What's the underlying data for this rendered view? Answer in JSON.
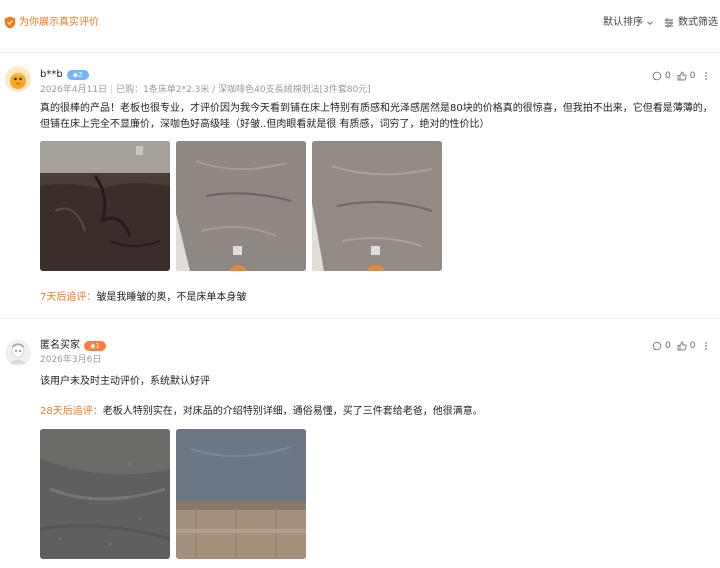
{
  "header": {
    "title": "为你展示真实评价",
    "sort_label": "默认排序",
    "digital_label": "数式筛选"
  },
  "reviews": [
    {
      "user": "b**b",
      "badge": "◆2",
      "date": "2026年4月11日",
      "purchased": "已购：1条床单2*2.3米 / 深咖啡色40支長絨棉刺法[3件套80元]",
      "comment_count": "0",
      "like_count": "0",
      "text_line1": "真的很棒的产品！老板也很专业，才评价因为我今天看到铺在床上特别有质感和光泽感居然是80块的价格真的很惊喜，但我拍不出来，它但看是薄薄的，",
      "text_line2": "但铺在床上完全不显廉价，深咖色好高级哇（好皱..但肉眼看就是很 有质感，词穷了，绝对的性价比）",
      "followup_tag": "7天后追评：",
      "followup_text": "皱是我睡皱的奥，不是床单本身皱"
    },
    {
      "user": "匿名买家",
      "badge": "◆1",
      "date": "2026年3月6日",
      "comment_count": "0",
      "like_count": "0",
      "text_line1": "该用户未及时主动评价，系统默认好评",
      "followup_tag": "28天后追评：",
      "followup_text": "老板人特别实在，对床品的介绍特别详细，通俗易懂，买了三件套给老爸，他很满意。"
    }
  ],
  "colors": {
    "accent": "#f07a1a",
    "meta": "#999999",
    "badge_blue": "#6fb6ff",
    "badge_orange": "#ff7a3d"
  }
}
